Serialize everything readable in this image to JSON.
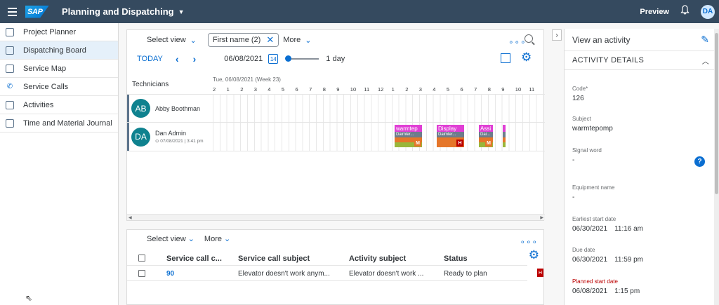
{
  "shellbar": {
    "logo": "SAP",
    "title": "Planning and Dispatching",
    "preview": "Preview",
    "avatar": "DA"
  },
  "nav": [
    {
      "label": "Project Planner",
      "icon": "project-icon"
    },
    {
      "label": "Dispatching Board",
      "icon": "board-icon",
      "active": true
    },
    {
      "label": "Service Map",
      "icon": "map-icon"
    },
    {
      "label": "Service Calls",
      "icon": "phone-icon"
    },
    {
      "label": "Activities",
      "icon": "clipboard-icon"
    },
    {
      "label": "Time and Material Journal",
      "icon": "journal-icon"
    }
  ],
  "board": {
    "select_view": "Select view",
    "filter_chip": "First name (2)",
    "more": "More",
    "today": "TODAY",
    "date": "06/08/2021",
    "calendar_day": "14",
    "range": "1 day",
    "tech_header": "Technicians",
    "week_label": "Tue, 06/08/2021 (Week 23)",
    "hours": [
      "2",
      "1",
      "2",
      "3",
      "4",
      "5",
      "6",
      "7",
      "8",
      "9",
      "10",
      "11",
      "12",
      "1",
      "2",
      "3",
      "4",
      "5",
      "6",
      "7",
      "8",
      "9",
      "10",
      "11"
    ],
    "technicians": [
      {
        "initials": "AB",
        "name": "Abby Boothman",
        "sub": ""
      },
      {
        "initials": "DA",
        "name": "Dan Admin",
        "sub": "07/08/2021 | 3:41 pm"
      }
    ],
    "activities": [
      {
        "title": "warmtep",
        "sub": "Daimler...",
        "badge": "M"
      },
      {
        "title": "Display",
        "sub": "Daimler...",
        "badge": "H"
      },
      {
        "title": "Assi",
        "sub": "Dai...",
        "badge": "M"
      }
    ]
  },
  "list": {
    "select_view": "Select view",
    "more": "More",
    "columns": [
      "Service call c...",
      "Service call subject",
      "Activity subject",
      "Status"
    ],
    "rows": [
      {
        "code": "90",
        "subject": "Elevator doesn't work anym...",
        "activity": "Elevator doesn't work ...",
        "status": "Ready to plan",
        "badge": "H"
      }
    ]
  },
  "details": {
    "title": "View an activity",
    "section": "ACTIVITY DETAILS",
    "fields": [
      {
        "label": "Code*",
        "value": "126"
      },
      {
        "label": "Subject",
        "value": "warmtepomp"
      },
      {
        "label": "Signal word",
        "value": "-"
      },
      {
        "label": "Equipment name",
        "value": "-"
      },
      {
        "label": "Earliest start date",
        "date": "06/30/2021",
        "time": "11:16 am"
      },
      {
        "label": "Due date",
        "date": "06/30/2021",
        "time": "11:59 pm"
      },
      {
        "label": "Planned start date",
        "date": "06/08/2021",
        "time": "1:15 pm"
      }
    ]
  },
  "colors": {
    "shell": "#354a5f",
    "accent": "#0a6ed1",
    "activity": "#e03fd5",
    "danger": "#bb0000"
  }
}
